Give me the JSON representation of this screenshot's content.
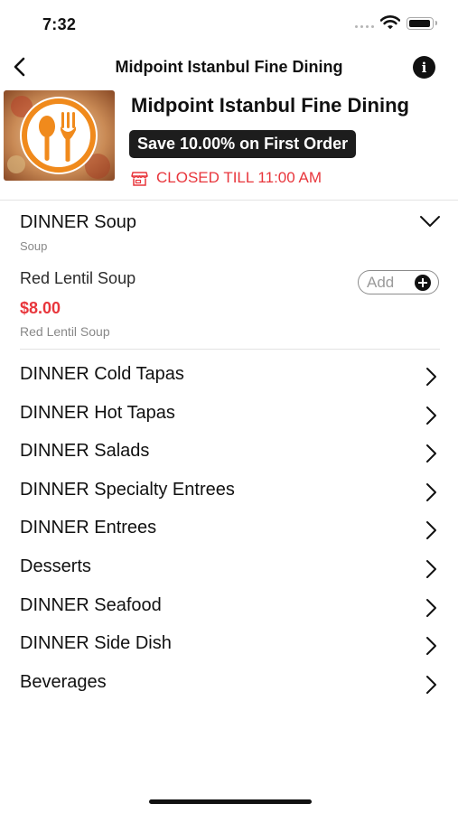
{
  "status_bar": {
    "time": "7:32"
  },
  "nav": {
    "title": "Midpoint Istanbul Fine Dining",
    "back_icon": "chevron-left-icon",
    "info_icon": "info-icon"
  },
  "restaurant": {
    "name": "Midpoint Istanbul Fine Dining",
    "promo": "Save 10.00% on First Order",
    "status": "CLOSED TILL 11:00 AM",
    "status_icon": "store-icon",
    "accent_color": "#e8363c",
    "logo_color": "#f08a1c"
  },
  "expanded_category": {
    "title": "DINNER Soup",
    "subtitle": "Soup",
    "items": [
      {
        "name": "Red Lentil Soup",
        "price": "$8.00",
        "description": "Red Lentil Soup",
        "add_label": "Add"
      }
    ]
  },
  "categories": [
    {
      "label": "DINNER Cold Tapas"
    },
    {
      "label": "DINNER Hot Tapas"
    },
    {
      "label": "DINNER Salads"
    },
    {
      "label": "DINNER Specialty Entrees"
    },
    {
      "label": "DINNER Entrees"
    },
    {
      "label": "Desserts"
    },
    {
      "label": "DINNER Seafood"
    },
    {
      "label": "DINNER Side Dish"
    },
    {
      "label": "Beverages"
    }
  ]
}
